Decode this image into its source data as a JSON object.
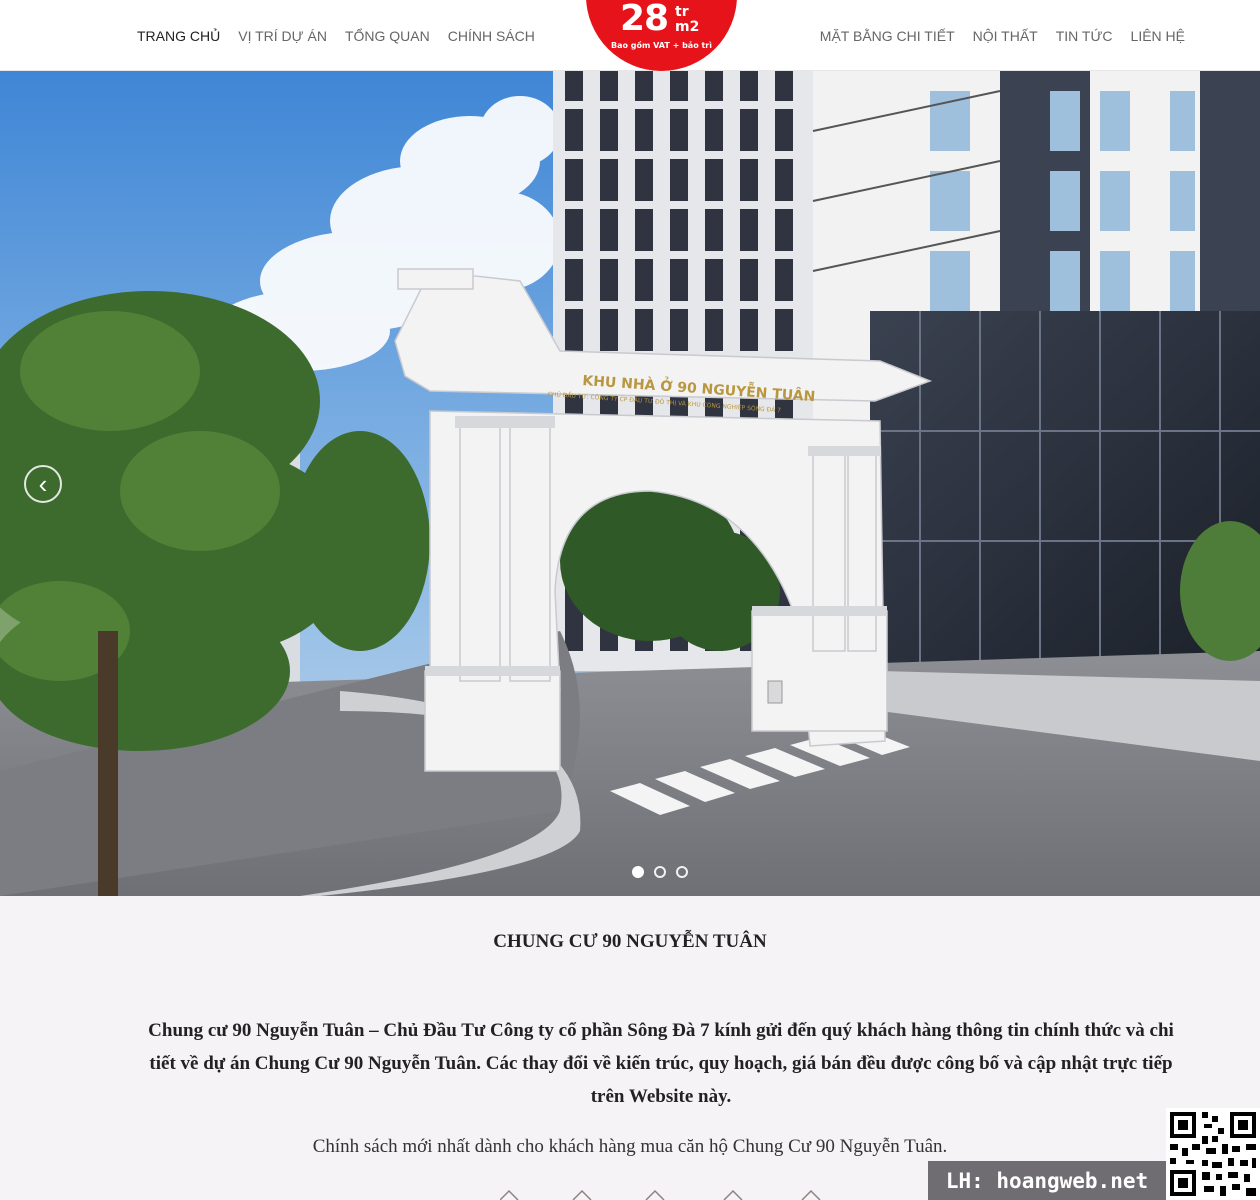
{
  "nav": {
    "left": [
      {
        "label": "TRANG CHỦ"
      },
      {
        "label": "VỊ TRÍ DỰ ÁN"
      },
      {
        "label": "TỔNG QUAN"
      },
      {
        "label": "CHÍNH SÁCH"
      }
    ],
    "right": [
      {
        "label": "MẶT BẰNG CHI TIẾT"
      },
      {
        "label": "NỘI THẤT"
      },
      {
        "label": "TIN TỨC"
      },
      {
        "label": "LIÊN HỆ"
      }
    ]
  },
  "logo": {
    "price": "28",
    "unit_top": "tr",
    "unit_bottom": "m2",
    "note": "Bao gồm VAT + bảo trì"
  },
  "hero": {
    "gate_sign": "KHU NHÀ Ở 90 NGUYỄN TUÂN",
    "gate_subsign": "CHỦ ĐẦU TƯ: CÔNG TY CP ĐẦU TƯ ĐÔ THỊ VÀ KHU CÔNG NGHIỆP SÔNG ĐÀ 7",
    "prev_arrow": "‹",
    "slide_count": 3,
    "active_slide": 1
  },
  "content": {
    "title": "CHUNG CƯ 90 NGUYỄN TUÂN",
    "intro": "Chung cư 90 Nguyễn Tuân – Chủ Đầu Tư Công ty cổ phần Sông Đà 7 kính gửi đến quý khách hàng thông tin chính thức và chi tiết về dự án Chung Cư 90 Nguyễn Tuân. Các thay đổi về kiến trúc, quy hoạch, giá bán đều được công bố và cập nhật trực tiếp trên Website này.",
    "policy": "Chính sách mới nhất dành cho khách hàng mua căn hộ Chung Cư 90 Nguyễn Tuân."
  },
  "contact": {
    "label": "LH: hoangweb.net"
  },
  "colors": {
    "brand_red": "#e7131a",
    "gold": "#b9973f",
    "contact_bg": "#6f6d72"
  }
}
